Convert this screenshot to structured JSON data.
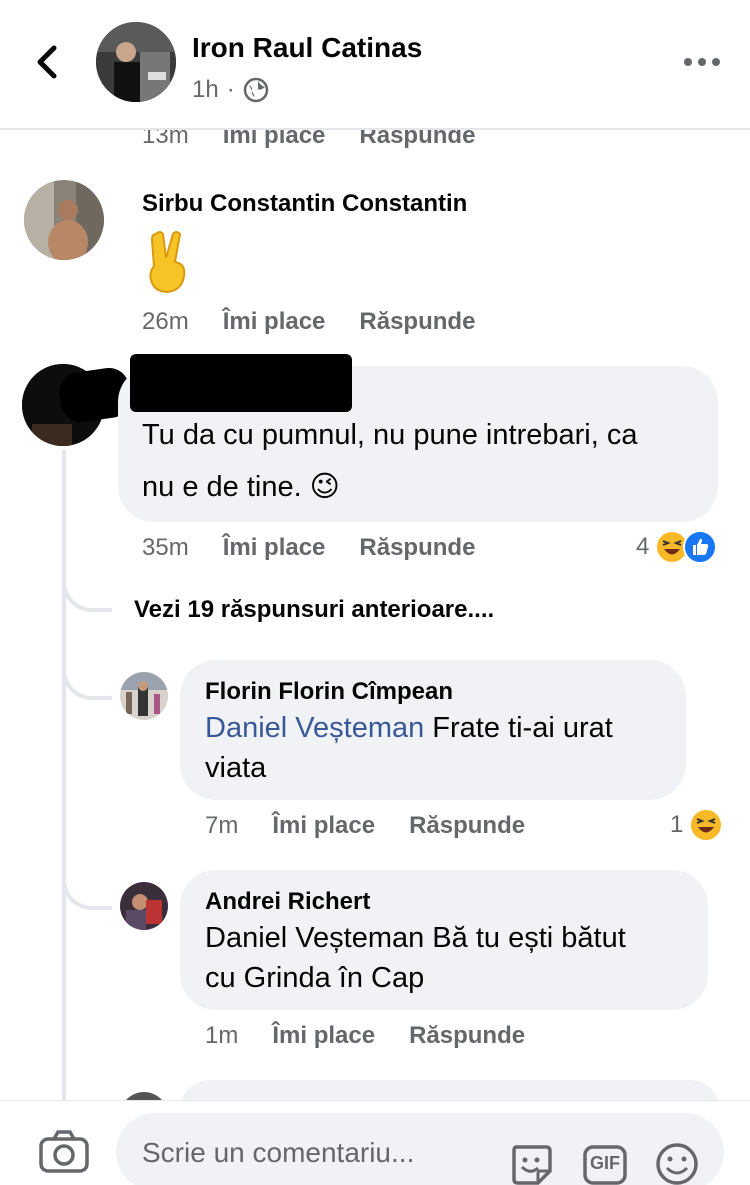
{
  "post": {
    "author": "Iron Raul Catinas",
    "time": "1h",
    "separator": "·",
    "icons": {
      "back": "chevron-left-icon",
      "privacy": "globe-icon",
      "more": "more-dots-icon"
    }
  },
  "cutoff_row": {
    "time": "13m",
    "like": "Îmi place",
    "reply": "Răspunde"
  },
  "comments": [
    {
      "name": "Sirbu Constantin Constantin",
      "text": "✌️",
      "time": "26m",
      "like": "Îmi place",
      "reply": "Răspunde"
    },
    {
      "name": "",
      "text_line1": "Tu da cu pumnul, nu pune intrebari, ca",
      "text_line2": "nu e de tine. 😉",
      "time": "35m",
      "like": "Îmi place",
      "reply": "Răspunde",
      "reactions": {
        "count": "4",
        "types": [
          "haha",
          "like"
        ]
      }
    }
  ],
  "view_more": "Vezi 19 răspunsuri anterioare....",
  "replies": [
    {
      "name": "Florin Florin Cîmpean",
      "mention": "Daniel Veșteman",
      "text_line1": " Frate ti-ai urat",
      "text_line2": "viata",
      "time": "7m",
      "like": "Îmi place",
      "reply": "Răspunde",
      "reactions": {
        "count": "1",
        "types": [
          "haha"
        ]
      }
    },
    {
      "name": "Andrei Richert",
      "text_line1": "Daniel Veșteman  Bă tu ești bătut",
      "text_line2": "cu Grinda în Cap",
      "time": "1m",
      "like": "Îmi place",
      "reply": "Răspunde"
    }
  ],
  "composer": {
    "placeholder": "Scrie un comentariu...",
    "gif_label": "GIF",
    "icons": [
      "camera-icon",
      "sticker-icon",
      "gif-icon",
      "emoji-icon"
    ]
  },
  "colors": {
    "link": "#385898",
    "bubble": "#f0f2f5",
    "secondary_text": "#65676b",
    "like_blue": "#1877f2",
    "haha_yellow": "#f7b928"
  }
}
